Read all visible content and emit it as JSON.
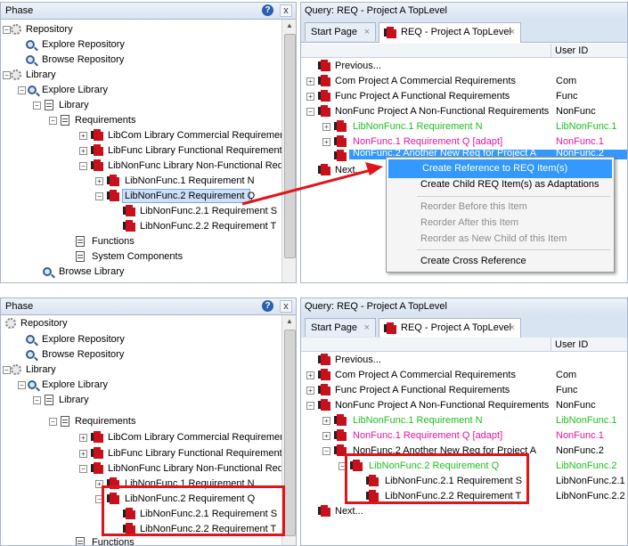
{
  "top": {
    "phase": {
      "title": "Phase",
      "help_icon": "?",
      "close_icon": "x",
      "tree": [
        {
          "label": "Repository",
          "icon": "gear-icon"
        },
        {
          "label": "Explore Repository",
          "icon": "magnifier-icon"
        },
        {
          "label": "Browse Repository",
          "icon": "magnifier-icon"
        },
        {
          "label": "Library",
          "icon": "gear-icon"
        },
        {
          "label": "Explore Library",
          "icon": "magnifier-icon"
        },
        {
          "label": "Library",
          "icon": "library-icon"
        },
        {
          "label": "Requirements",
          "icon": "library-icon"
        },
        {
          "label": "LibCom Library Commercial Requirements",
          "icon": "requirement-icon"
        },
        {
          "label": "LibFunc Library Functional Requirements",
          "icon": "requirement-icon"
        },
        {
          "label": "LibNonFunc Library Non-Functional Requirements",
          "icon": "requirement-icon"
        },
        {
          "label": "LibNonFunc.1 Requirement N",
          "icon": "requirement-icon"
        },
        {
          "label": "LibNonFunc.2 Requirement Q",
          "icon": "requirement-icon"
        },
        {
          "label": "LibNonFunc.2.1 Requirement S",
          "icon": "requirement-icon"
        },
        {
          "label": "LibNonFunc.2.2 Requirement T",
          "icon": "requirement-icon"
        },
        {
          "label": "Functions",
          "icon": "library-icon"
        },
        {
          "label": "System Components",
          "icon": "library-icon"
        },
        {
          "label": "Browse Library",
          "icon": "magnifier-icon"
        }
      ]
    },
    "query": {
      "title": "Query: REQ - Project A TopLevel",
      "tabs": [
        {
          "label": "Start Page"
        },
        {
          "label": "REQ - Project A TopLevel"
        }
      ],
      "tab_close": "×",
      "column_user_id": "User ID",
      "rows": [
        {
          "name": "Previous...",
          "uid": ""
        },
        {
          "name": "Com Project A Commercial Requirements",
          "uid": "Com"
        },
        {
          "name": "Func Project A Functional Requirements",
          "uid": "Func"
        },
        {
          "name": "NonFunc Project A Non-Functional Requirements",
          "uid": "NonFunc"
        },
        {
          "name": "LibNonFunc.1 Requirement N",
          "uid": "LibNonFunc.1"
        },
        {
          "name": "NonFunc.1 Requirement Q [adapt]",
          "uid": "NonFunc.1"
        },
        {
          "name": "NonFunc.2 Another New Req for Project A",
          "uid": "NonFunc.2"
        },
        {
          "name": "Next...",
          "uid": ""
        }
      ]
    },
    "context_menu": [
      "Create Reference to REQ Item(s)",
      "Create Child REQ Item(s) as Adaptations",
      "Reorder Before this Item",
      "Reorder After this Item",
      "Reorder as New Child of this Item",
      "Create Cross Reference"
    ]
  },
  "bottom": {
    "phase": {
      "title": "Phase",
      "help_icon": "?",
      "close_icon": "x",
      "tree": [
        {
          "label": "Repository"
        },
        {
          "label": "Explore Repository"
        },
        {
          "label": "Browse Repository"
        },
        {
          "label": "Library"
        },
        {
          "label": "Explore Library"
        },
        {
          "label": "Library"
        },
        {
          "label": "Requirements"
        },
        {
          "label": "LibCom Library Commercial Requirements"
        },
        {
          "label": "LibFunc Library Functional Requirements"
        },
        {
          "label": "LibNonFunc Library Non-Functional Requirements"
        },
        {
          "label": "LibNonFunc.1 Requirement N"
        },
        {
          "label": "LibNonFunc.2 Requirement Q"
        },
        {
          "label": "LibNonFunc.2.1 Requirement S"
        },
        {
          "label": "LibNonFunc.2.2 Requirement T"
        },
        {
          "label": "Functions"
        }
      ]
    },
    "query": {
      "title": "Query: REQ - Project A TopLevel",
      "tabs": [
        {
          "label": "Start Page"
        },
        {
          "label": "REQ - Project A TopLevel"
        }
      ],
      "tab_close": "×",
      "column_user_id": "User ID",
      "rows": [
        {
          "name": "Previous...",
          "uid": ""
        },
        {
          "name": "Com Project A Commercial Requirements",
          "uid": "Com"
        },
        {
          "name": "Func Project A Functional Requirements",
          "uid": "Func"
        },
        {
          "name": "NonFunc Project A Non-Functional Requirements",
          "uid": "NonFunc"
        },
        {
          "name": "LibNonFunc.1 Requirement N",
          "uid": "LibNonFunc.1"
        },
        {
          "name": "NonFunc.1 Requirement Q [adapt]",
          "uid": "NonFunc.1"
        },
        {
          "name": "NonFunc.2 Another New Req for Project A",
          "uid": "NonFunc.2"
        },
        {
          "name": "LibNonFunc.2 Requirement Q",
          "uid": "LibNonFunc.2"
        },
        {
          "name": "LibNonFunc.2.1 Requirement S",
          "uid": "LibNonFunc.2.1"
        },
        {
          "name": "LibNonFunc.2.2 Requirement T",
          "uid": "LibNonFunc.2.2"
        },
        {
          "name": "Next...",
          "uid": ""
        }
      ]
    }
  },
  "colors": {
    "selection": "#3399ff",
    "highlight_box": "#e0151c",
    "library_text": "#1fbf1f",
    "adapt_text": "#e0159f",
    "requirement_icon": "#c8101d"
  }
}
